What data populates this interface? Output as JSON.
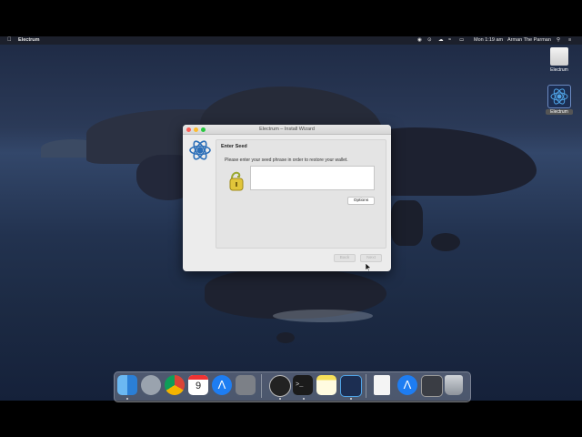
{
  "menubar": {
    "app_name": "Electrum",
    "clock": "Mon 1:19 am",
    "user": "Arman The Parman"
  },
  "desktop": {
    "drive_label": "Electrum",
    "app_label": "Electrum"
  },
  "window": {
    "title": "Electrum  –  Install Wizard",
    "heading": "Enter Seed",
    "prompt": "Please enter your seed phrase in order to restore your wallet.",
    "seed_value": "",
    "options_label": "Options",
    "back_label": "Back",
    "next_label": "Next"
  },
  "dock": {
    "calendar_day": "9",
    "items": [
      "finder-icon",
      "launchpad-icon",
      "chrome-icon",
      "calendar-icon",
      "app-store-icon",
      "system-preferences-icon",
      "obs-icon",
      "terminal-icon",
      "notes-icon",
      "electrum-icon",
      "document-icon",
      "app-store-folder-icon",
      "screenshot-icon",
      "trash-icon"
    ]
  },
  "colors": {
    "accent": "#2c6fb8",
    "window_bg": "#ececec",
    "panel_bg": "#e4e4e4",
    "close": "#fc5f57",
    "minimize": "#fdbc2e",
    "zoom": "#28c840"
  }
}
